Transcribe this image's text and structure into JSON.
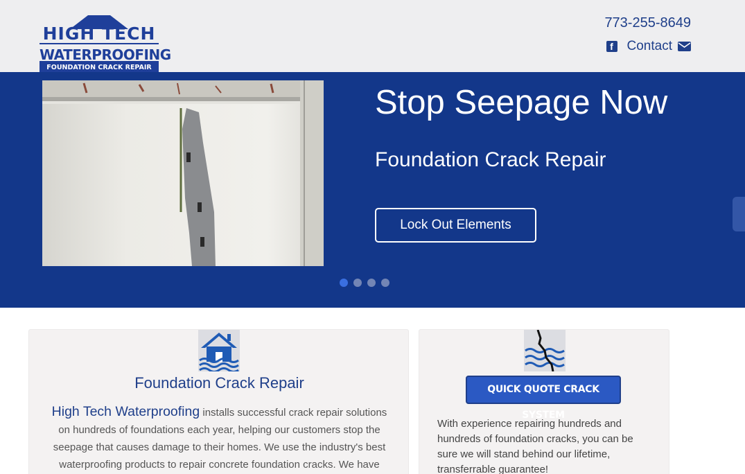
{
  "header": {
    "logo": {
      "line1": "HIGH TECH",
      "line2": "WATERPROOFING",
      "line3": "FOUNDATION CRACK REPAIR"
    },
    "phone": "773-255-8649",
    "contact_label": "Contact",
    "icons": [
      "facebook-icon",
      "envelope-icon"
    ]
  },
  "hero": {
    "title": "Stop Seepage Now",
    "subtitle": "Foundation Crack Repair",
    "button_label": "Lock Out Elements",
    "slides": 4,
    "active_slide": 1,
    "image": "basement-wall-crack-photo"
  },
  "cards": {
    "left": {
      "icon": "flooded-house-icon",
      "title": "Foundation Crack Repair",
      "brand": "High Tech Waterproofing",
      "body": " installs successful crack repair solutions on hundreds of foundations each year, helping our customers stop the seepage that causes damage to their homes. We use the industry's best waterproofing products to repair concrete foundation cracks. We have"
    },
    "right": {
      "icon": "cracked-wall-water-icon",
      "button_label": "QUICK QUOTE CRACK SYSTEM",
      "body": "With experience repairing hundreds and hundreds of foundation cracks, you can be sure we will stand behind our lifetime, transferrable guarantee!"
    }
  },
  "colors": {
    "brand_blue": "#13378a",
    "header_bg": "#eeeef0",
    "text_blue": "#1f3f8a",
    "button_blue": "#2b59c3"
  }
}
